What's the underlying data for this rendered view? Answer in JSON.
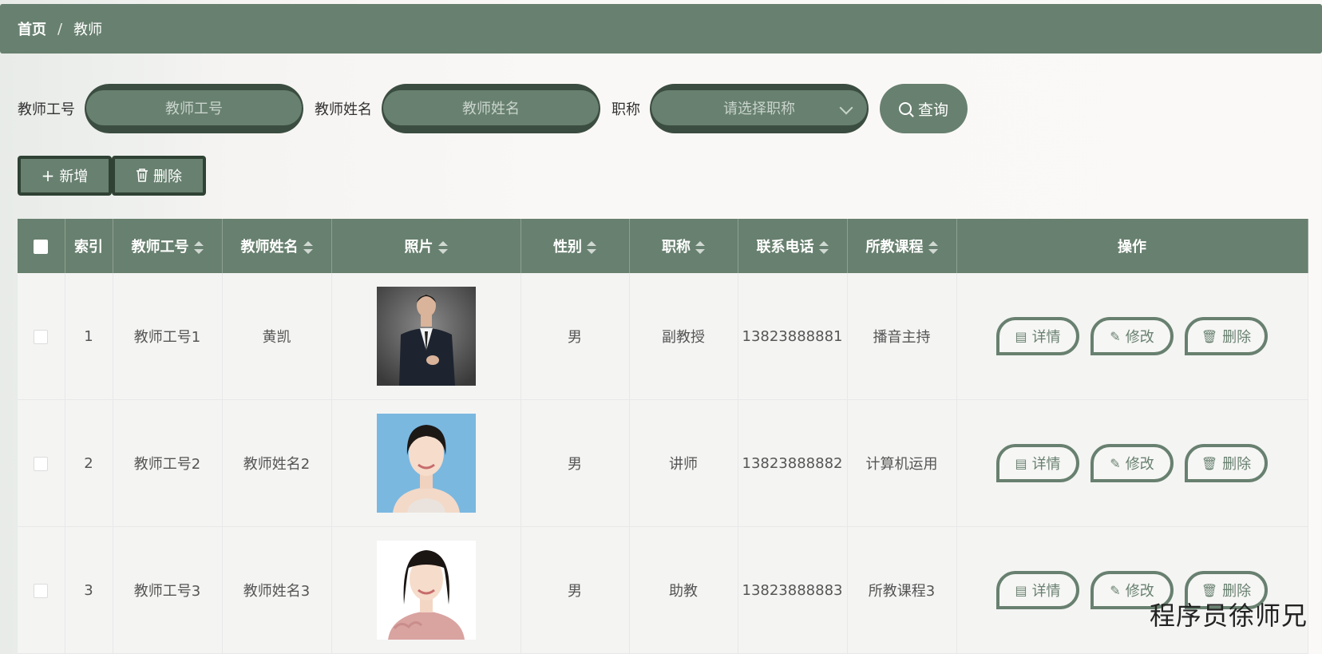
{
  "breadcrumb": {
    "home": "首页",
    "separator": "/",
    "current": "教师"
  },
  "search": {
    "teacher_no_label": "教师工号",
    "teacher_no_placeholder": "教师工号",
    "teacher_name_label": "教师姓名",
    "teacher_name_placeholder": "教师姓名",
    "title_label": "职称",
    "title_placeholder": "请选择职称",
    "query_button": "查询"
  },
  "toolbar": {
    "add_label": "新增",
    "delete_label": "删除"
  },
  "table": {
    "columns": [
      "索引",
      "教师工号",
      "教师姓名",
      "照片",
      "性别",
      "职称",
      "联系电话",
      "所教课程",
      "操作"
    ],
    "rows": [
      {
        "index": "1",
        "teacher_no": "教师工号1",
        "name": "黄凯",
        "gender": "男",
        "title": "副教授",
        "phone": "13823888881",
        "course": "播音主持"
      },
      {
        "index": "2",
        "teacher_no": "教师工号2",
        "name": "教师姓名2",
        "gender": "男",
        "title": "讲师",
        "phone": "13823888882",
        "course": "计算机运用"
      },
      {
        "index": "3",
        "teacher_no": "教师工号3",
        "name": "教师姓名3",
        "gender": "男",
        "title": "助教",
        "phone": "13823888883",
        "course": "所教课程3"
      }
    ],
    "actions": {
      "detail": "详情",
      "edit": "修改",
      "delete": "删除"
    }
  },
  "watermark": "程序员徐师兄",
  "colors": {
    "primary": "#68806f",
    "dark": "#3b4d40",
    "row_bg": "#f4f4f3"
  }
}
